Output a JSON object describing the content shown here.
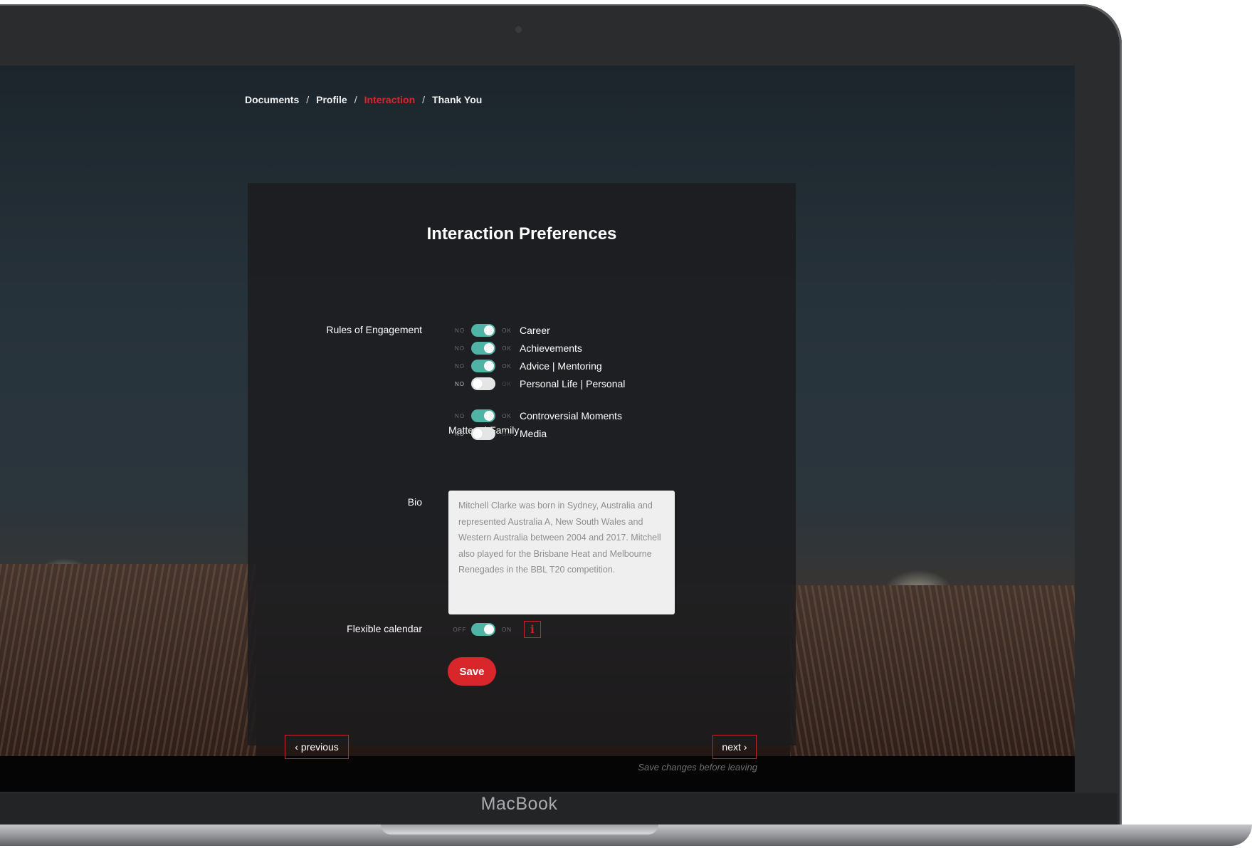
{
  "device": {
    "brand": "MacBook"
  },
  "breadcrumb": {
    "items": [
      "Documents",
      "Profile",
      "Interaction",
      "Thank You"
    ],
    "separator": "/",
    "active_index": 2
  },
  "form": {
    "title": "Interaction Preferences",
    "rules_label": "Rules of Engagement",
    "rules": [
      {
        "label": "Career",
        "off_text": "NO",
        "on_text": "OK",
        "enabled": true
      },
      {
        "label": "Achievements",
        "off_text": "NO",
        "on_text": "OK",
        "enabled": true
      },
      {
        "label": "Advice | Mentoring",
        "off_text": "NO",
        "on_text": "OK",
        "enabled": true
      },
      {
        "label": "Personal Life | Personal",
        "label_cont": "Matters | Family",
        "off_text": "NO",
        "on_text": "OK",
        "enabled": false
      },
      {
        "label": "Controversial Moments",
        "off_text": "NO",
        "on_text": "OK",
        "enabled": true
      },
      {
        "label": "Media",
        "off_text": "NO",
        "on_text": "OK",
        "enabled": false
      }
    ],
    "bio_label": "Bio",
    "bio_value": "Mitchell Clarke was born in Sydney, Australia and represented Australia A, New South Wales and Western Australia between 2004 and 2017. Mitchell also played for the Brisbane Heat and Melbourne Renegades in the BBL T20 competition.",
    "calendar_label": "Flexible calendar",
    "calendar_toggle": {
      "off_text": "OFF",
      "on_text": "ON",
      "enabled": true
    },
    "info_icon": "info-icon",
    "save_label": "Save",
    "previous_label": "previous",
    "next_label": "next",
    "save_hint": "Save changes before leaving"
  },
  "colors": {
    "accent": "#d9262b",
    "toggle_on": "#4fb3a6",
    "toggle_off": "#e5e5e5",
    "panel": "#1c1c1e"
  }
}
